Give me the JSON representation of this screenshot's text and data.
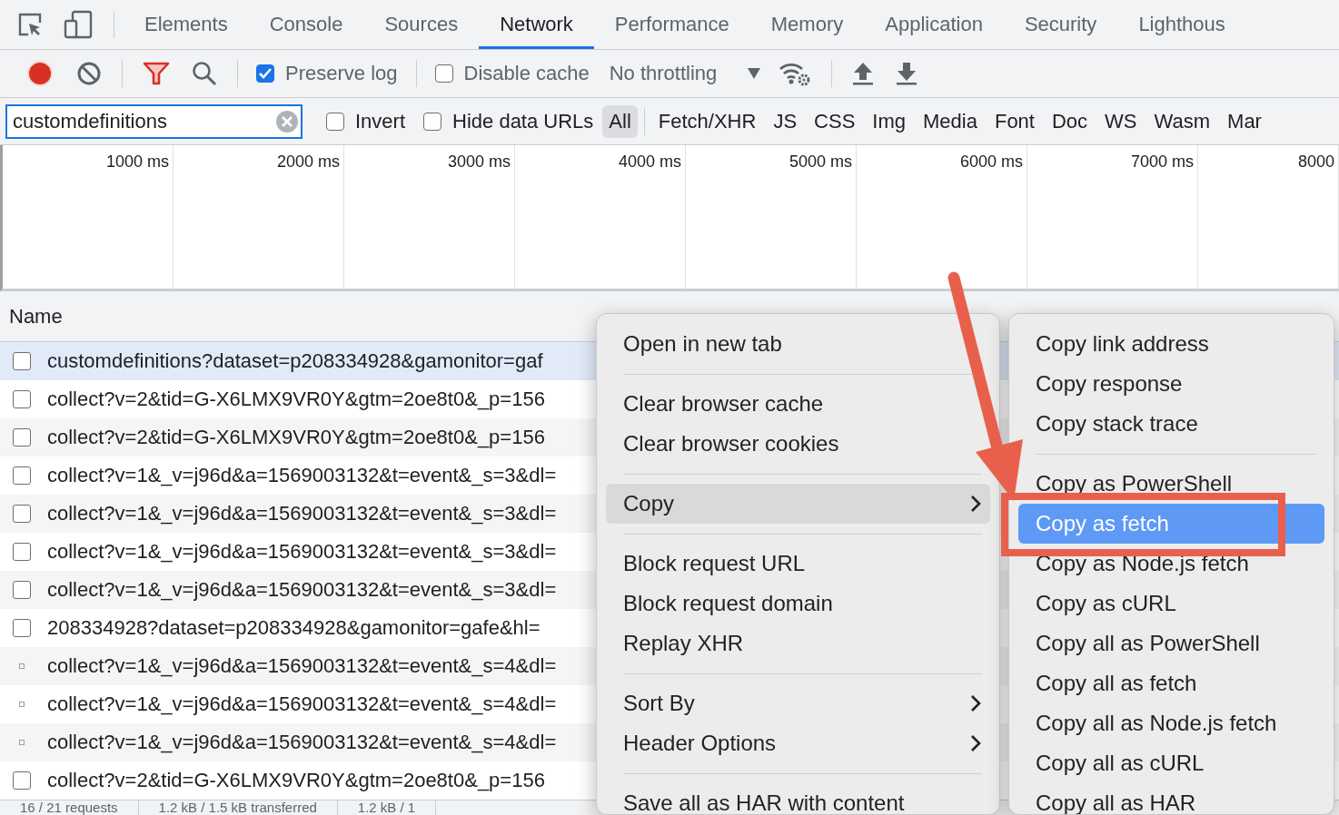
{
  "tabs": [
    {
      "label": "Elements",
      "selected": false
    },
    {
      "label": "Console",
      "selected": false
    },
    {
      "label": "Sources",
      "selected": false
    },
    {
      "label": "Network",
      "selected": true
    },
    {
      "label": "Performance",
      "selected": false
    },
    {
      "label": "Memory",
      "selected": false
    },
    {
      "label": "Application",
      "selected": false
    },
    {
      "label": "Security",
      "selected": false
    },
    {
      "label": "Lighthous",
      "selected": false
    }
  ],
  "toolbar": {
    "recording": true,
    "filter_on": true,
    "preserve_log": {
      "label": "Preserve log",
      "checked": true
    },
    "disable_cache": {
      "label": "Disable cache",
      "checked": false
    },
    "throttling": "No throttling"
  },
  "filter_bar": {
    "search": {
      "value": "customdefinitions"
    },
    "options": [
      {
        "label": "Invert",
        "checked": false
      },
      {
        "label": "Hide data URLs",
        "checked": false
      }
    ],
    "types": [
      {
        "label": "All",
        "selected": true
      },
      {
        "label": "Fetch/XHR",
        "selected": false
      },
      {
        "label": "JS",
        "selected": false
      },
      {
        "label": "CSS",
        "selected": false
      },
      {
        "label": "Img",
        "selected": false
      },
      {
        "label": "Media",
        "selected": false
      },
      {
        "label": "Font",
        "selected": false
      },
      {
        "label": "Doc",
        "selected": false
      },
      {
        "label": "WS",
        "selected": false
      },
      {
        "label": "Wasm",
        "selected": false
      },
      {
        "label": "Mar",
        "selected": false
      }
    ]
  },
  "timeline": {
    "ticks": [
      "1000 ms",
      "2000 ms",
      "3000 ms",
      "4000 ms",
      "5000 ms",
      "6000 ms",
      "7000 ms",
      "8000"
    ]
  },
  "table": {
    "columns": [
      "Name"
    ],
    "rows": [
      {
        "name": "customdefinitions?dataset=p208334928&gamonitor=gaf",
        "kind": "checkbox",
        "selected": true
      },
      {
        "name": "collect?v=2&tid=G-X6LMX9VR0Y&gtm=2oe8t0&_p=156",
        "kind": "checkbox",
        "selected": false
      },
      {
        "name": "collect?v=2&tid=G-X6LMX9VR0Y&gtm=2oe8t0&_p=156",
        "kind": "checkbox",
        "selected": false
      },
      {
        "name": "collect?v=1&_v=j96d&a=1569003132&t=event&_s=3&dl=",
        "kind": "checkbox",
        "selected": false
      },
      {
        "name": "collect?v=1&_v=j96d&a=1569003132&t=event&_s=3&dl=",
        "kind": "checkbox",
        "selected": false
      },
      {
        "name": "collect?v=1&_v=j96d&a=1569003132&t=event&_s=3&dl=",
        "kind": "checkbox",
        "selected": false
      },
      {
        "name": "collect?v=1&_v=j96d&a=1569003132&t=event&_s=3&dl=",
        "kind": "checkbox",
        "selected": false
      },
      {
        "name": "208334928?dataset=p208334928&gamonitor=gafe&hl=",
        "kind": "checkbox",
        "selected": false
      },
      {
        "name": "collect?v=1&_v=j96d&a=1569003132&t=event&_s=4&dl=",
        "kind": "dot",
        "selected": false
      },
      {
        "name": "collect?v=1&_v=j96d&a=1569003132&t=event&_s=4&dl=",
        "kind": "dot",
        "selected": false
      },
      {
        "name": "collect?v=1&_v=j96d&a=1569003132&t=event&_s=4&dl=",
        "kind": "dot",
        "selected": false
      },
      {
        "name": "collect?v=2&tid=G-X6LMX9VR0Y&gtm=2oe8t0&_p=156",
        "kind": "checkbox",
        "selected": false
      }
    ]
  },
  "status_bar": [
    "16 / 21 requests",
    "1.2 kB / 1.5 kB transferred",
    "1.2 kB / 1"
  ],
  "context_menu": {
    "items": [
      {
        "kind": "item",
        "label": "Open in new tab",
        "submenu": false,
        "selected": false
      },
      {
        "kind": "separator"
      },
      {
        "kind": "item",
        "label": "Clear browser cache",
        "submenu": false,
        "selected": false
      },
      {
        "kind": "item",
        "label": "Clear browser cookies",
        "submenu": false,
        "selected": false
      },
      {
        "kind": "separator"
      },
      {
        "kind": "item",
        "label": "Copy",
        "submenu": true,
        "selected": true
      },
      {
        "kind": "separator"
      },
      {
        "kind": "item",
        "label": "Block request URL",
        "submenu": false,
        "selected": false
      },
      {
        "kind": "item",
        "label": "Block request domain",
        "submenu": false,
        "selected": false
      },
      {
        "kind": "item",
        "label": "Replay XHR",
        "submenu": false,
        "selected": false
      },
      {
        "kind": "separator"
      },
      {
        "kind": "item",
        "label": "Sort By",
        "submenu": true,
        "selected": false
      },
      {
        "kind": "item",
        "label": "Header Options",
        "submenu": true,
        "selected": false
      },
      {
        "kind": "separator"
      },
      {
        "kind": "item",
        "label": "Save all as HAR with content",
        "submenu": false,
        "selected": false
      }
    ]
  },
  "copy_submenu": {
    "items": [
      {
        "kind": "item",
        "label": "Copy link address",
        "selected": false
      },
      {
        "kind": "item",
        "label": "Copy response",
        "selected": false
      },
      {
        "kind": "item",
        "label": "Copy stack trace",
        "selected": false
      },
      {
        "kind": "separator"
      },
      {
        "kind": "item",
        "label": "Copy as PowerShell",
        "selected": false
      },
      {
        "kind": "item",
        "label": "Copy as fetch",
        "selected": true
      },
      {
        "kind": "item",
        "label": "Copy as Node.js fetch",
        "selected": false
      },
      {
        "kind": "item",
        "label": "Copy as cURL",
        "selected": false
      },
      {
        "kind": "item",
        "label": "Copy all as PowerShell",
        "selected": false
      },
      {
        "kind": "item",
        "label": "Copy all as fetch",
        "selected": false
      },
      {
        "kind": "item",
        "label": "Copy all as Node.js fetch",
        "selected": false
      },
      {
        "kind": "item",
        "label": "Copy all as cURL",
        "selected": false
      },
      {
        "kind": "item",
        "label": "Copy all as HAR",
        "selected": false
      }
    ]
  },
  "callout": {
    "kind": "arrow_and_frame"
  }
}
